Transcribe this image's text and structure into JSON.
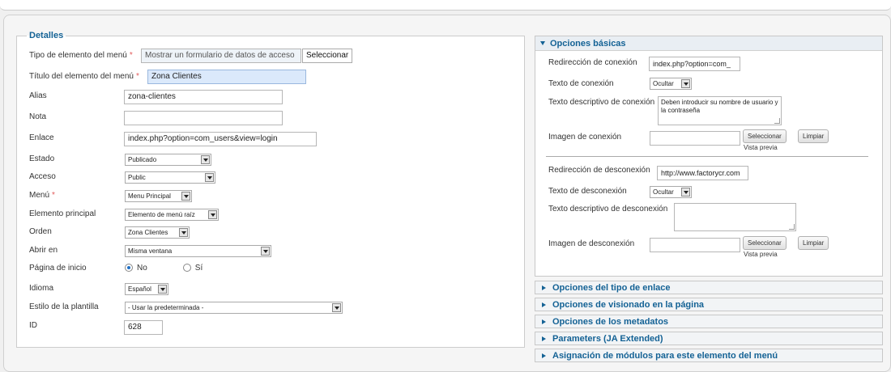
{
  "details": {
    "legend": "Detalles",
    "tipo_label": "Tipo de elemento del menú",
    "tipo_value": "Mostrar un formulario de datos de acceso",
    "tipo_button": "Seleccionar",
    "titulo_label": "Título del elemento del menú",
    "titulo_value": "Zona Clientes",
    "alias_label": "Alias",
    "alias_value": "zona-clientes",
    "nota_label": "Nota",
    "nota_value": "",
    "enlace_label": "Enlace",
    "enlace_value": "index.php?option=com_users&view=login",
    "estado_label": "Estado",
    "estado_value": "Publicado",
    "acceso_label": "Acceso",
    "acceso_value": "Public",
    "menu_label": "Menú",
    "menu_value": "Menu Principal",
    "elemento_label": "Elemento principal",
    "elemento_value": "Elemento de menú raíz",
    "orden_label": "Orden",
    "orden_value": "Zona Clientes",
    "abrir_label": "Abrir en",
    "abrir_value": "Misma ventana",
    "inicio_label": "Página de inicio",
    "inicio_no": "No",
    "inicio_si": "Sí",
    "idioma_label": "Idioma",
    "idioma_value": "Español",
    "estilo_label": "Estilo de la plantilla",
    "estilo_value": "- Usar la predeterminada -",
    "id_label": "ID",
    "id_value": "628",
    "required_mark": "*"
  },
  "basic": {
    "title": "Opciones básicas",
    "redir_con_label": "Redirección de conexión",
    "redir_con_value": "index.php?option=com_",
    "texto_con_label": "Texto de conexión",
    "texto_con_value": "Ocultar",
    "desc_con_label": "Texto descriptivo de conexión",
    "desc_con_value": "Deben introducir su nombre de usuario y la contraseña",
    "img_con_label": "Imagen de conexión",
    "img_con_value": "",
    "select_btn": "Seleccionar",
    "clear_btn": "Limpiar",
    "preview": "Vista previa",
    "redir_des_label": "Redirección de desconexión",
    "redir_des_value": "http://www.factorycr.com",
    "texto_des_label": "Texto de desconexión",
    "texto_des_value": "Ocultar",
    "desc_des_label": "Texto descriptivo de desconexión",
    "desc_des_value": "",
    "img_des_label": "Imagen de desconexión",
    "img_des_value": ""
  },
  "closed_panels": [
    "Opciones del tipo de enlace",
    "Opciones de visionado en la página",
    "Opciones de los metadatos",
    "Parameters (JA Extended)",
    "Asignación de módulos para este elemento del menú"
  ],
  "colors": {
    "accent": "#146295",
    "required": "#e25b5b",
    "highlight": "#dbe9fb"
  }
}
